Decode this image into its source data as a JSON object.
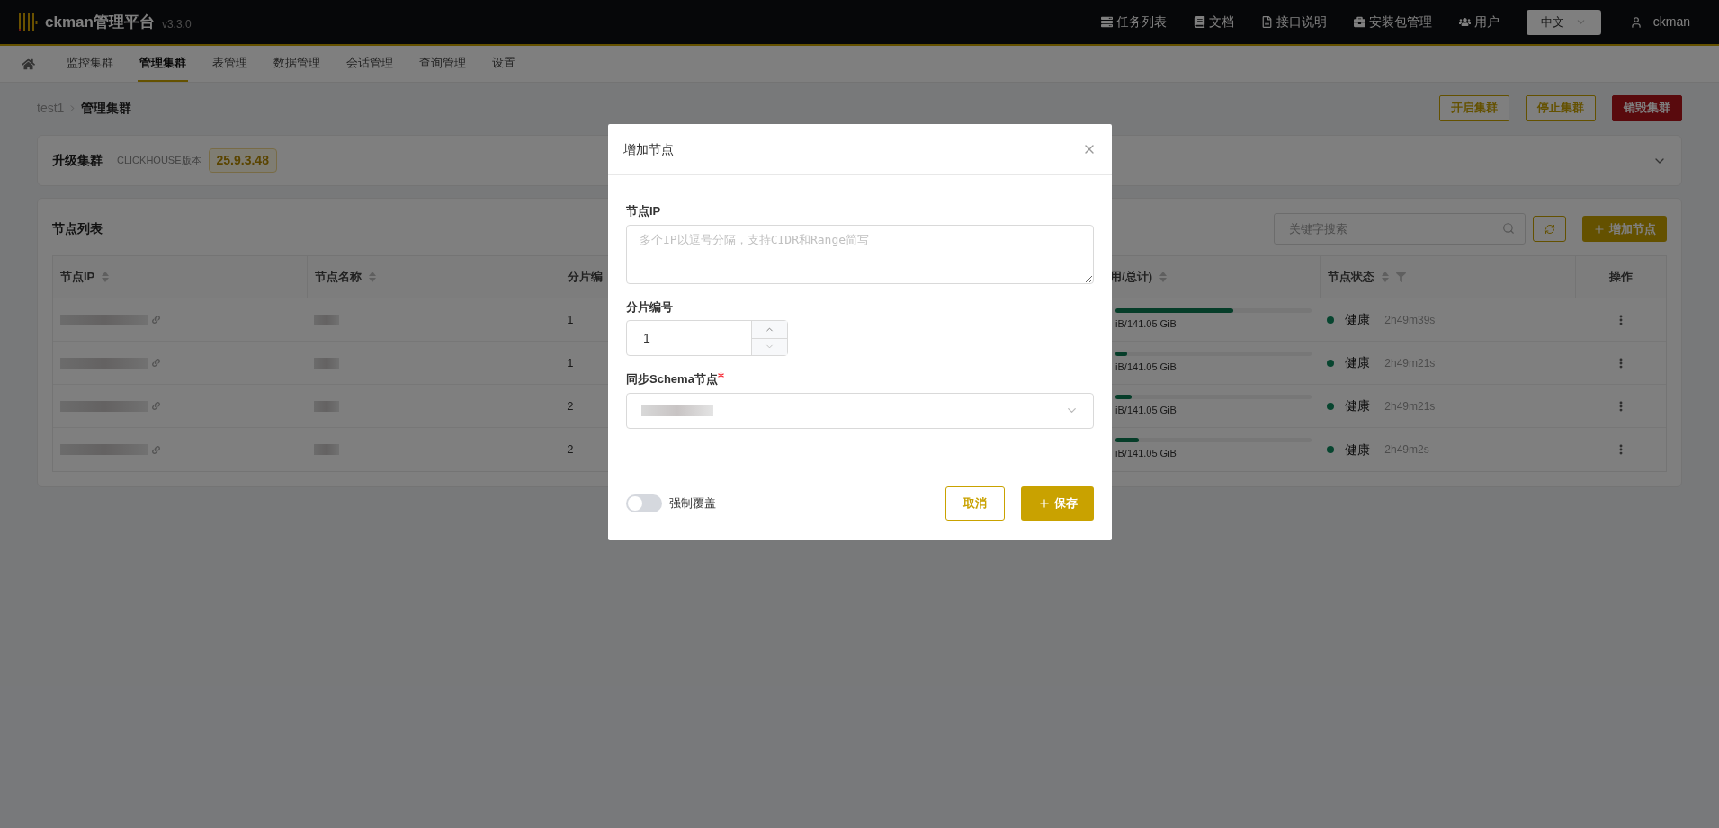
{
  "header": {
    "brand": "ckman管理平台",
    "version": "v3.3.0",
    "menu": [
      "任务列表",
      "文档",
      "接口说明",
      "安装包管理",
      "用户"
    ],
    "language": "中文",
    "user": "ckman"
  },
  "nav": [
    {
      "label": "监控集群",
      "selected": false
    },
    {
      "label": "管理集群",
      "selected": true
    },
    {
      "label": "表管理",
      "selected": false
    },
    {
      "label": "数据管理",
      "selected": false
    },
    {
      "label": "会话管理",
      "selected": false
    },
    {
      "label": "查询管理",
      "selected": false
    },
    {
      "label": "设置",
      "selected": false
    }
  ],
  "breadcrumb": [
    "test1",
    "管理集群"
  ],
  "cluster_actions": [
    {
      "label": "开启集群",
      "kind": "outline"
    },
    {
      "label": "停止集群",
      "kind": "outline"
    },
    {
      "label": "销毁集群",
      "kind": "danger"
    }
  ],
  "upgrade": {
    "title": "升级集群",
    "version_label": "CLICKHOUSE版本",
    "version": "25.9.3.48"
  },
  "node_list": {
    "title": "节点列表",
    "search_placeholder": "关键字搜索",
    "add_button": "增加节点",
    "columns": [
      {
        "label": "节点IP",
        "sortable": true,
        "filter": false
      },
      {
        "label": "节点名称",
        "sortable": true,
        "filter": false
      },
      {
        "label": "分片编",
        "sortable": false,
        "filter": false
      },
      {
        "label": "用/总计)",
        "sortable": true,
        "filter": false
      },
      {
        "label": "节点状态",
        "sortable": true,
        "filter": true
      },
      {
        "label": "操作",
        "sortable": false,
        "filter": false
      }
    ],
    "rows": [
      {
        "shard": "1",
        "disk": "iB/141.05 GiB",
        "level": 0.6,
        "status": "健康",
        "uptime": "2h49m39s"
      },
      {
        "shard": "1",
        "disk": "iB/141.05 GiB",
        "level": 0.06,
        "status": "健康",
        "uptime": "2h49m21s"
      },
      {
        "shard": "2",
        "disk": "iB/141.05 GiB",
        "level": 0.08,
        "status": "健康",
        "uptime": "2h49m21s"
      },
      {
        "shard": "2",
        "disk": "iB/141.05 GiB",
        "level": 0.12,
        "status": "健康",
        "uptime": "2h49m2s"
      }
    ]
  },
  "modal": {
    "title": "增加节点",
    "fields": [
      {
        "kind": "textarea",
        "label": "节点IP",
        "required": false,
        "placeholder": "多个IP以逗号分隔，支持CIDR和Range简写"
      },
      {
        "kind": "number",
        "label": "分片编号",
        "required": false,
        "value": "1"
      },
      {
        "kind": "select",
        "label": "同步Schema节点",
        "required": true
      }
    ],
    "force_toggle": {
      "label": "强制覆盖",
      "on": false
    },
    "buttons": [
      {
        "label": "取消",
        "kind": "outline"
      },
      {
        "label": "保存",
        "kind": "primary"
      }
    ]
  }
}
